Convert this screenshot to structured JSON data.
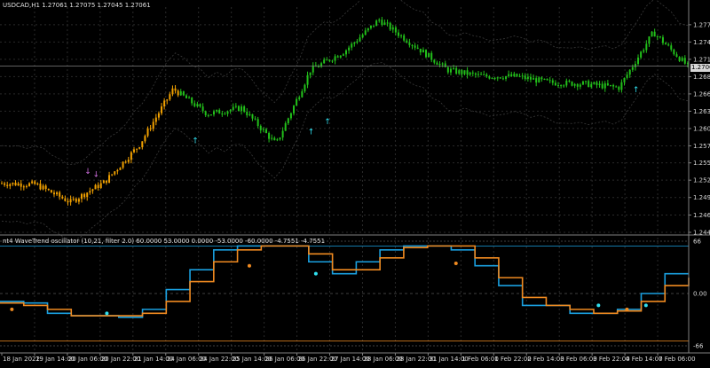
{
  "header": {
    "symbol_info": "USDCAD,H1  1.27061  1.27075  1.27045  1.27061",
    "indicator_info": "nt4 WaveTrend oscillator (10,21, filter 2.0) 60.0000 53.0000 0.0000 -53.0000 -60.0000 -4.7551 -4.7551"
  },
  "price_axis": {
    "ticks": [
      "1.27720",
      "1.27445",
      "1.27170",
      "1.26895",
      "1.26620",
      "1.26345",
      "1.26070",
      "1.25795",
      "1.25524",
      "1.25249",
      "1.24974",
      "1.24695",
      "1.24420"
    ],
    "current_price": "1.27061"
  },
  "osc_axis": {
    "ticks": [
      "66",
      "0.00",
      "-66"
    ]
  },
  "time_axis": {
    "labels": [
      "18 Jan 2022",
      "19 Jan 14:00",
      "20 Jan 06:00",
      "20 Jan 22:00",
      "21 Jan 14:00",
      "24 Jan 06:00",
      "24 Jan 22:00",
      "25 Jan 14:00",
      "26 Jan 06:00",
      "26 Jan 22:00",
      "27 Jan 14:00",
      "28 Jan 06:00",
      "28 Jan 22:00",
      "31 Jan 14:00",
      "1 Feb 06:00",
      "1 Feb 22:00",
      "2 Feb 14:00",
      "3 Feb 06:00",
      "3 Feb 22:00",
      "4 Feb 14:00",
      "7 Feb 06:00"
    ]
  },
  "colors": {
    "background": "#000000",
    "bull": "#22c01a",
    "bear": "#f0a000",
    "wavetrend_fast": "#1aa0e0",
    "wavetrend_slow": "#f08a20",
    "signal_up": "#30e0f0",
    "signal_down": "#d070e0",
    "grid": "#2a2a2a"
  },
  "chart_data": [
    {
      "type": "candlestick",
      "title": "USDCAD,H1",
      "ylim": [
        1.2442,
        1.28
      ],
      "approx_close_path": [
        {
          "x": "18 Jan 2022",
          "y": 1.252
        },
        {
          "x": "19 Jan 14:00",
          "y": 1.2518
        },
        {
          "x": "20 Jan 06:00",
          "y": 1.249
        },
        {
          "x": "20 Jan 22:00",
          "y": 1.2522
        },
        {
          "x": "21 Jan 14:00",
          "y": 1.258
        },
        {
          "x": "24 Jan 06:00",
          "y": 1.267
        },
        {
          "x": "24 Jan 22:00",
          "y": 1.263
        },
        {
          "x": "25 Jan 14:00",
          "y": 1.264
        },
        {
          "x": "26 Jan 06:00",
          "y": 1.2582
        },
        {
          "x": "26 Jan 22:00",
          "y": 1.27
        },
        {
          "x": "27 Jan 14:00",
          "y": 1.273
        },
        {
          "x": "28 Jan 06:00",
          "y": 1.278
        },
        {
          "x": "28 Jan 22:00",
          "y": 1.274
        },
        {
          "x": "31 Jan 14:00",
          "y": 1.27
        },
        {
          "x": "1 Feb 06:00",
          "y": 1.269
        },
        {
          "x": "1 Feb 22:00",
          "y": 1.269
        },
        {
          "x": "2 Feb 14:00",
          "y": 1.268
        },
        {
          "x": "3 Feb 06:00",
          "y": 1.2678
        },
        {
          "x": "3 Feb 22:00",
          "y": 1.2672
        },
        {
          "x": "4 Feb 14:00",
          "y": 1.276
        },
        {
          "x": "7 Feb 06:00",
          "y": 1.2706
        }
      ]
    },
    {
      "type": "line",
      "title": "WaveTrend oscillator",
      "ylim": [
        -66,
        66
      ],
      "series": [
        {
          "values": [
            -10,
            -12,
            -25,
            -28,
            -28,
            -30,
            -20,
            5,
            30,
            55,
            60,
            60,
            60,
            40,
            25,
            40,
            55,
            60,
            60,
            55,
            35,
            10,
            -15,
            -15,
            -25,
            -25,
            -20,
            0,
            25,
            25
          ]
        },
        {
          "values": [
            -12,
            -15,
            -20,
            -28,
            -28,
            -28,
            -25,
            -10,
            15,
            40,
            55,
            60,
            60,
            50,
            30,
            30,
            45,
            58,
            60,
            60,
            45,
            20,
            -5,
            -15,
            -20,
            -25,
            -22,
            -10,
            10,
            20
          ]
        }
      ]
    }
  ]
}
